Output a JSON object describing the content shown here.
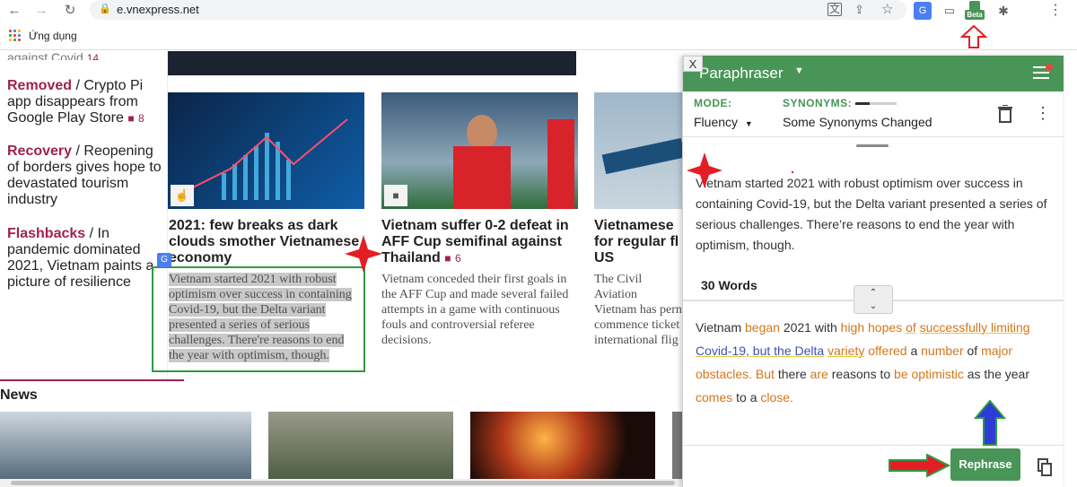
{
  "browser": {
    "url": "e.vnexpress.net",
    "back_glyph": "←",
    "forward_glyph": "→",
    "reload_glyph": "↻",
    "lock_glyph": "🔒",
    "ext_beta_label": "Beta",
    "bookmarks_apps_label": "Ứng dụng"
  },
  "left_column": {
    "partial_top": "against Covid",
    "partial_top_count": "14",
    "stories": [
      {
        "kw": "Removed",
        "text": " / Crypto Pi app disappears from Google Play Store",
        "count": "8"
      },
      {
        "kw": "Recovery",
        "text": " / Reopening of borders gives hope to devastated tourism industry",
        "count": ""
      },
      {
        "kw": "Flashbacks",
        "text": " / In pandemic dominated 2021, Vietnam paints a picture of resilience",
        "count": ""
      }
    ]
  },
  "articles": [
    {
      "title": "2021: few breaks as dark clouds smother Vietnamese economy",
      "lead": "Vietnam started 2021 with robust optimism over success in containing Covid-19, but the Delta variant presented a series of serious challenges. There're reasons to end the year with optimism, though."
    },
    {
      "title": "Vietnam suffer 0-2 defeat in AFF Cup semifinal against Thailand",
      "count": "6",
      "lead": "Vietnam conceded their first goals in the AFF Cup and made several failed attempts in a game with continuous fouls and controversial referee decisions."
    },
    {
      "title": "Vietnamese for regular fl US",
      "lead": "The Civil Aviation Vietnam has pern commence ticket international flig U.S. scheduled to"
    }
  ],
  "news_section_label": "News",
  "paraphraser": {
    "close_label": "X",
    "title": "Paraphraser",
    "mode_label": "MODE:",
    "mode_value": "Fluency",
    "synonyms_label": "SYNONYMS:",
    "synonyms_value": "Some Synonyms Changed",
    "synonyms_level": 0.35,
    "input_text": "Vietnam started 2021 with robust optimism over success in containing Covid-19, but the Delta variant presented a series of serious challenges. There’re reasons to end the year with optimism, though.",
    "word_count": "30 Words",
    "swap_up": "⌃",
    "swap_down": "⌄",
    "output_segments": [
      {
        "t": "Vietnam ",
        "k": "plain"
      },
      {
        "t": "began",
        "k": "chg"
      },
      {
        "t": " 2021 with ",
        "k": "plain"
      },
      {
        "t": "high hopes",
        "k": "chg"
      },
      {
        "t": " ",
        "k": "plain"
      },
      {
        "t": "of",
        "k": "chg-u"
      },
      {
        "t": " ",
        "k": "plain"
      },
      {
        "t": "successfully limiting",
        "k": "chg-u"
      },
      {
        "t": " ",
        "k": "plain"
      },
      {
        "t": "Covid-19, but the Delta",
        "k": "struct"
      },
      {
        "t": " ",
        "k": "plain"
      },
      {
        "t": "variety",
        "k": "chg-u"
      },
      {
        "t": " ",
        "k": "plain"
      },
      {
        "t": "offered",
        "k": "chg"
      },
      {
        "t": " a ",
        "k": "plain"
      },
      {
        "t": "number",
        "k": "chg"
      },
      {
        "t": " of ",
        "k": "plain"
      },
      {
        "t": "major obstacles. But",
        "k": "chg"
      },
      {
        "t": " there ",
        "k": "plain"
      },
      {
        "t": "are",
        "k": "chg"
      },
      {
        "t": " reasons to ",
        "k": "plain"
      },
      {
        "t": "be optimistic",
        "k": "chg"
      },
      {
        "t": " as the year ",
        "k": "plain"
      },
      {
        "t": "comes",
        "k": "chg"
      },
      {
        "t": " to a ",
        "k": "plain"
      },
      {
        "t": "close.",
        "k": "chg"
      }
    ],
    "rephrase_label": "Rephrase"
  },
  "colors": {
    "brand_green": "#499557",
    "vnexpress_red": "#9f224e",
    "change_orange": "#d4761a",
    "structure_blue": "#3f51b5",
    "annotation_red": "#e31e24"
  }
}
